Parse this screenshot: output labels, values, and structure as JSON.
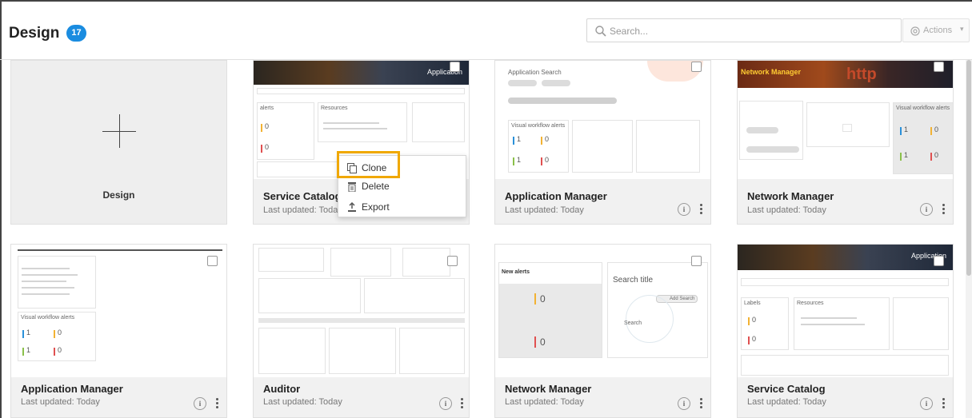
{
  "header": {
    "title": "Design",
    "count": "17",
    "search_placeholder": "Search...",
    "actions_label": "Actions",
    "badge_color": "#1a8ce0"
  },
  "new_card": {
    "label": "Design"
  },
  "cards": [
    {
      "name": "Service Catalog",
      "updated": "Last updated: Today"
    },
    {
      "name": "Application Manager",
      "updated": "Last updated: Today"
    },
    {
      "name": "Network Manager",
      "updated": "Last updated: Today"
    },
    {
      "name": "Application Manager",
      "updated": "Last updated: Today"
    },
    {
      "name": "Auditor",
      "updated": "Last updated: Today"
    },
    {
      "name": "Network Manager",
      "updated": "Last updated: Today"
    },
    {
      "name": "Service Catalog",
      "updated": "Last updated: Today"
    }
  ],
  "thumb_text": {
    "application": "Application",
    "application_search": "Application Search",
    "network_manager": "Network Manager",
    "http": "http",
    "visual_workflow_alerts": "Visual workflow alerts",
    "new_alerts": "New alerts",
    "search_title": "Search title",
    "search": "Search",
    "add_search": "Add Search",
    "alerts": "alerts",
    "resources": "Resources",
    "labels": "Labels",
    "num_0": "0",
    "num_1": "1"
  },
  "context_menu": {
    "items": [
      {
        "label": "Clone",
        "icon": "clone-icon"
      },
      {
        "label": "Delete",
        "icon": "trash-icon"
      },
      {
        "label": "Export",
        "icon": "export-icon"
      }
    ],
    "highlight_color": "#f0a800"
  },
  "info_glyph": "i"
}
